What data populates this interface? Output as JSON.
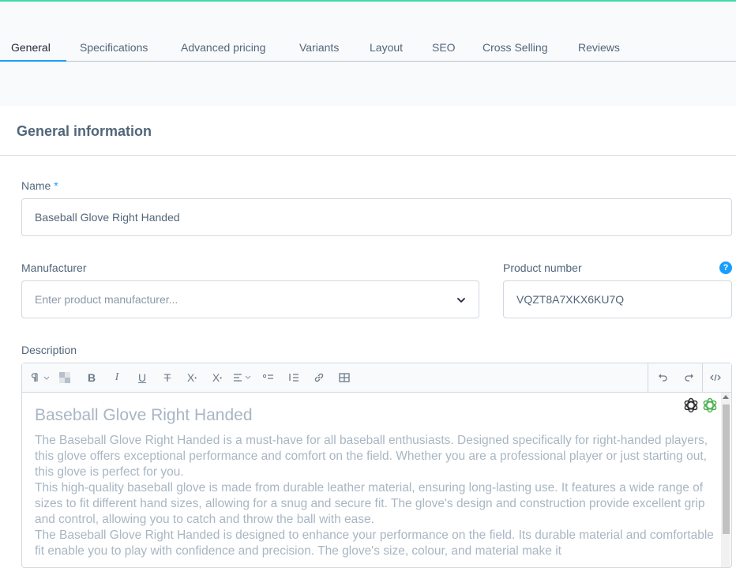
{
  "tabs": [
    {
      "label": "General",
      "active": true
    },
    {
      "label": "Specifications"
    },
    {
      "label": "Advanced pricing"
    },
    {
      "label": "Variants"
    },
    {
      "label": "Layout"
    },
    {
      "label": "SEO"
    },
    {
      "label": "Cross Selling"
    },
    {
      "label": "Reviews"
    }
  ],
  "card": {
    "title": "General information"
  },
  "name": {
    "label": "Name",
    "required_marker": "*",
    "value": "Baseball Glove Right Handed"
  },
  "manufacturer": {
    "label": "Manufacturer",
    "placeholder": "Enter product manufacturer..."
  },
  "product_number": {
    "label": "Product number",
    "value": "VQZT8A7XKX6KU7Q",
    "help": "?"
  },
  "description": {
    "label": "Description",
    "toolbar": [
      "paragraph-format-icon",
      "clear-format-icon",
      "bold-icon",
      "italic-icon",
      "underline-icon",
      "strikethrough-icon",
      "superscript-icon",
      "subscript-icon",
      "align-icon",
      "unordered-list-icon",
      "ordered-list-icon",
      "link-icon",
      "table-icon",
      "undo-icon",
      "redo-icon",
      "code-view-icon"
    ],
    "heading": "Baseball Glove Right Handed",
    "paragraphs": [
      "The Baseball Glove Right Handed is a must-have for all baseball enthusiasts. Designed specifically for right-handed players, this glove offers exceptional performance and comfort on the field. Whether you are a professional player or just starting out, this glove is perfect for you.",
      "This high-quality baseball glove is made from durable leather material, ensuring long-lasting use. It features a wide range of sizes to fit different hand sizes, allowing for a snug and secure fit. The glove's design and construction provide excellent grip and control, allowing you to catch and throw the ball with ease.",
      "The Baseball Glove Right Handed is designed to enhance your performance on the field. Its durable material and comfortable fit enable you to play with confidence and precision. The glove's size, colour, and material make it"
    ]
  },
  "colors": {
    "accent": "#189eff",
    "top_bar": "#3ddba4",
    "text": "#52667a"
  }
}
